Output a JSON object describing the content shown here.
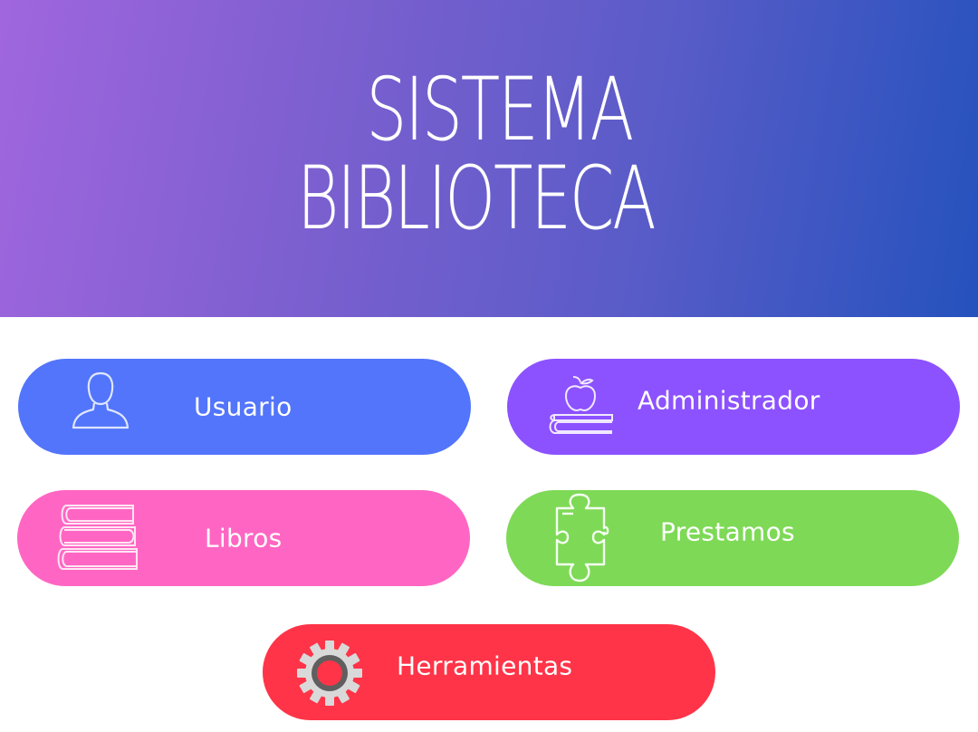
{
  "header": {
    "title_line1": "SISTEMA",
    "title_line2": "BIBLIOTECA",
    "gradient_colors": [
      "#a066de",
      "#2552bd"
    ]
  },
  "menu": [
    {
      "key": "usuario",
      "label": "Usuario",
      "icon": "user-icon",
      "color": "#5275fb"
    },
    {
      "key": "administrador",
      "label": "Administrador",
      "icon": "apple-on-book-icon",
      "color": "#8c52ff"
    },
    {
      "key": "libros",
      "label": "Libros",
      "icon": "book-stack-icon",
      "color": "#ff66c3"
    },
    {
      "key": "prestamos",
      "label": "Prestamos",
      "icon": "puzzle-piece-icon",
      "color": "#7ed957"
    },
    {
      "key": "herramientas",
      "label": "Herramientas",
      "icon": "gear-icon",
      "color": "#ff3448"
    }
  ]
}
